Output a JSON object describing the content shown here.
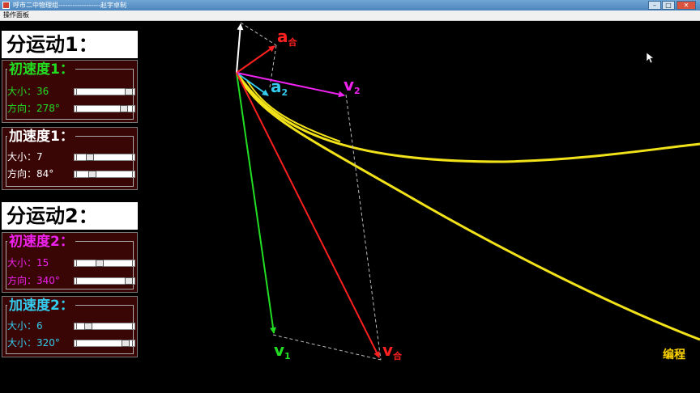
{
  "window": {
    "title": "呼市二中物理组------------------赵宇卓制"
  },
  "menu": {
    "item": "操作面板"
  },
  "motion1": {
    "title": "分运动1：",
    "velocity": {
      "heading": "初速度1：",
      "size_label": "大小：36",
      "dir_label": "方向：278°",
      "color": "#22dd22"
    },
    "acceleration": {
      "heading": "加速度1：",
      "size_label": "大小：7",
      "dir_label": "方向：84°",
      "color": "#ffffff"
    }
  },
  "motion2": {
    "title": "分运动2：",
    "velocity": {
      "heading": "初速度2：",
      "size_label": "大小：15",
      "dir_label": "方向：340°",
      "color": "#ee22ee"
    },
    "acceleration": {
      "heading": "加速度2：",
      "size_label": "大小：6",
      "dir_label": "大小：320°",
      "color": "#33ccee"
    }
  },
  "vectors": {
    "a_sum": {
      "main": "a",
      "sub": "合",
      "color": "#ff2020"
    },
    "a2": {
      "main": "a",
      "sub": "2",
      "color": "#33ccee"
    },
    "v2": {
      "main": "v",
      "sub": "2",
      "color": "#ee22ee"
    },
    "v1": {
      "main": "v",
      "sub": "1",
      "color": "#22dd22"
    },
    "v_sum": {
      "main": "v",
      "sub": "合",
      "color": "#ff2020"
    }
  },
  "trajectory_color": "#f2e21a",
  "footer": {
    "credit": "编程"
  }
}
